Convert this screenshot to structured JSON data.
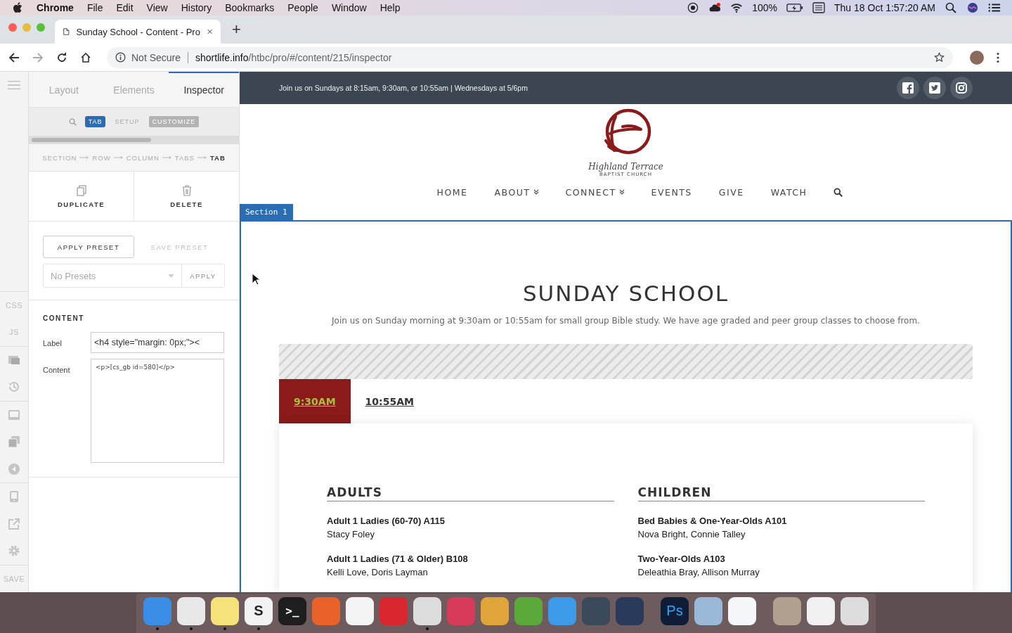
{
  "menubar": {
    "app": "Chrome",
    "menus": [
      "File",
      "Edit",
      "View",
      "History",
      "Bookmarks",
      "People",
      "Window",
      "Help"
    ],
    "battery": "100%",
    "clock": "Thu 18 Oct  1:57:20 AM"
  },
  "browser": {
    "tab_title": "Sunday School - Content - Pro",
    "new_tab": "+",
    "security": "Not Secure",
    "url_host": "shortlife.info",
    "url_path": "/htbc/pro/#/content/215/inspector"
  },
  "rail": [
    {
      "kind": "text",
      "label": "CSS"
    },
    {
      "kind": "text",
      "label": "JS"
    },
    {
      "kind": "media"
    },
    {
      "kind": "history"
    },
    {
      "kind": "footer"
    },
    {
      "kind": "layers"
    },
    {
      "kind": "back"
    },
    {
      "kind": "device"
    },
    {
      "kind": "external"
    },
    {
      "kind": "settings"
    },
    {
      "kind": "text",
      "label": "SAVE"
    }
  ],
  "panel": {
    "tabs": [
      {
        "label": "Layout",
        "selected": false
      },
      {
        "label": "Elements",
        "selected": false
      },
      {
        "label": "Inspector",
        "selected": true
      }
    ],
    "element_type": "TAB",
    "modes": [
      {
        "label": "SETUP",
        "selected": false
      },
      {
        "label": "CUSTOMIZE",
        "selected": true
      }
    ],
    "breadcrumb": [
      {
        "label": "SECTION",
        "current": false
      },
      {
        "label": "ROW",
        "current": false
      },
      {
        "label": "COLUMN",
        "current": false
      },
      {
        "label": "TABS",
        "current": false
      },
      {
        "label": "TAB",
        "current": true
      }
    ],
    "actions": [
      {
        "kind": "duplicate",
        "label": "DUPLICATE"
      },
      {
        "kind": "delete",
        "label": "DELETE"
      }
    ],
    "presets": {
      "apply_preset": "APPLY PRESET",
      "save_preset": "SAVE PRESET",
      "save_disabled": true,
      "select_placeholder": "No Presets",
      "apply": "APPLY"
    },
    "content": {
      "title": "CONTENT",
      "fields": [
        {
          "kind": "input",
          "label": "Label",
          "value": "<h4 style=\"margin: 0px;\"><"
        },
        {
          "kind": "textarea",
          "label": "Content",
          "value": "<p>[cs_gb id=580]</p>"
        }
      ]
    }
  },
  "site": {
    "topbar": "Join us on Sundays at 8:15am, 9:30am, or 10:55am | Wednesdays at 5/6pm",
    "social": [
      {
        "kind": "facebook"
      },
      {
        "kind": "twitter"
      },
      {
        "kind": "instagram"
      }
    ],
    "logo": {
      "name": "Highland Terrace",
      "subtitle": "BAPTIST CHURCH"
    },
    "nav": [
      {
        "label": "HOME",
        "dropdown": false
      },
      {
        "label": "ABOUT",
        "dropdown": true
      },
      {
        "label": "CONNECT",
        "dropdown": true
      },
      {
        "label": "EVENTS",
        "dropdown": false
      },
      {
        "label": "GIVE",
        "dropdown": false
      },
      {
        "label": "WATCH",
        "dropdown": false
      }
    ],
    "section_label": "Section 1",
    "heading": "SUNDAY SCHOOL",
    "intro": "Join us on Sunday morning at 9:30am or 10:55am for small group Bible study. We have age graded and peer group classes to choose from.",
    "tabs": [
      {
        "label": "9:30AM",
        "selected": true
      },
      {
        "label": "10:55AM",
        "selected": false
      }
    ],
    "columns": [
      {
        "title": "ADULTS",
        "classes": [
          {
            "name": "Adult 1 Ladies (60-70) A115",
            "teachers": "Stacy Foley"
          },
          {
            "name": "Adult 1 Ladies (71 & Older) B108",
            "teachers": "Kelli Love, Doris Layman"
          }
        ]
      },
      {
        "title": "CHILDREN",
        "classes": [
          {
            "name": "Bed Babies & One-Year-Olds A101",
            "teachers": "Nova Bright, Connie Talley"
          },
          {
            "name": "Two-Year-Olds A103",
            "teachers": "Deleathia Bray, Allison Murray"
          }
        ]
      }
    ]
  },
  "dock": [
    {
      "color": "#3a8ee6",
      "running": true
    },
    {
      "color": "#e8e8e8",
      "running": true
    },
    {
      "color": "#f6e27a",
      "running": true
    },
    {
      "color": "#f2f2f2",
      "running": true,
      "glyph": "S"
    },
    {
      "color": "#1e1e1e",
      "running": false,
      "glyph": ">_"
    },
    {
      "color": "#e8622a",
      "running": false
    },
    {
      "color": "#f4f4f4",
      "running": false
    },
    {
      "color": "#d9262f",
      "running": false
    },
    {
      "color": "#dcdcdc",
      "running": true
    },
    {
      "color": "#d63b5a",
      "running": false
    },
    {
      "color": "#e0a53a",
      "running": false
    },
    {
      "color": "#5aa93a",
      "running": false
    },
    {
      "color": "#3d9ae8",
      "running": false
    },
    {
      "color": "#3a4a5a",
      "running": false
    },
    {
      "color": "#2a3a5a",
      "running": false
    },
    {
      "color": "#0f1e36",
      "running": false,
      "glyph": "Ps"
    },
    {
      "color": "#9ab8d8",
      "running": false
    },
    {
      "color": "#f4f6fa",
      "running": false
    },
    {
      "color": "#b0a090",
      "running": false
    },
    {
      "color": "#f0f0f0",
      "running": false
    },
    {
      "color": "#dcdcdc",
      "running": false
    }
  ]
}
